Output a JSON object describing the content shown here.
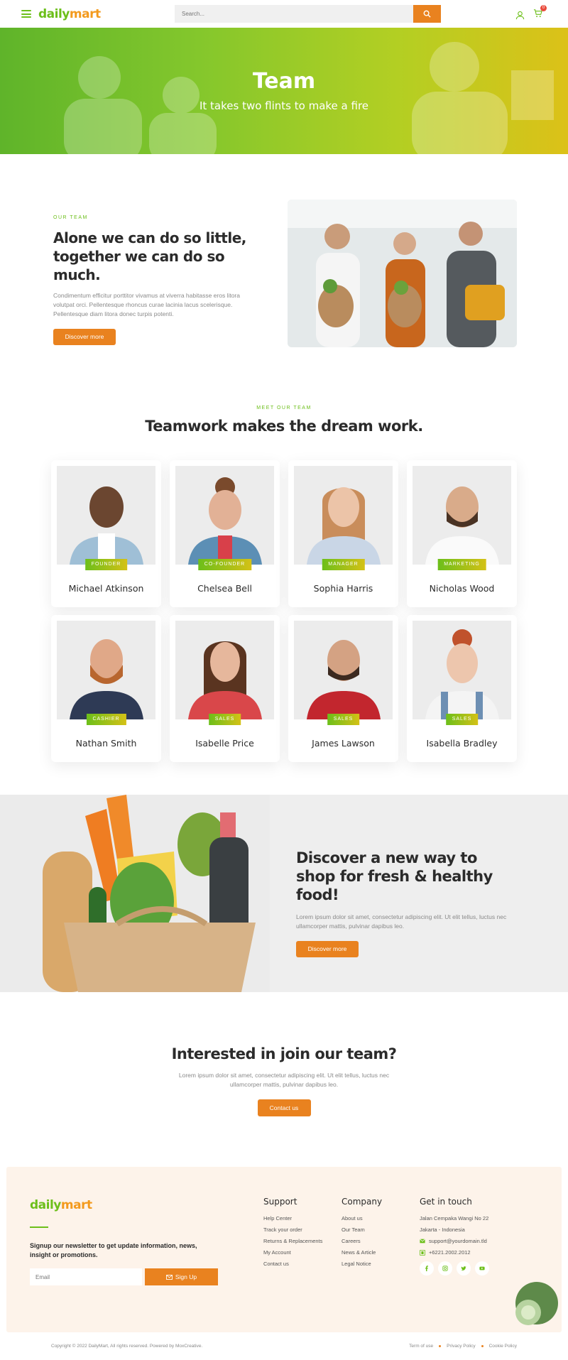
{
  "brand": {
    "logo_left": "daily",
    "logo_right": "mart",
    "green": "#6cbf1a",
    "orange": "#e9821f"
  },
  "header": {
    "search_placeholder": "Search...",
    "cart_count": "0"
  },
  "hero": {
    "title": "Team",
    "subtitle": "It takes two flints to make a fire"
  },
  "intro": {
    "eyebrow": "OUR TEAM",
    "heading": "Alone we can do so little, together we can do so much.",
    "description": "Condimentum efficitur porttitor vivamus at viverra habitasse eros litora volutpat orci. Pellentesque rhoncus curae lacinia lacus scelerisque. Pellentesque diam litora donec turpis potenti.",
    "button": "Discover more"
  },
  "team": {
    "eyebrow": "MEET OUR TEAM",
    "heading": "Teamwork makes the dream work.",
    "members": [
      {
        "role": "FOUNDER",
        "name": "Michael Atkinson"
      },
      {
        "role": "CO-FOUNDER",
        "name": "Chelsea Bell"
      },
      {
        "role": "MANAGER",
        "name": "Sophia Harris"
      },
      {
        "role": "MARKETING",
        "name": "Nicholas Wood"
      },
      {
        "role": "CASHIER",
        "name": "Nathan Smith"
      },
      {
        "role": "SALES",
        "name": "Isabelle Price"
      },
      {
        "role": "SALES",
        "name": "James Lawson"
      },
      {
        "role": "SALES",
        "name": "Isabella Bradley"
      }
    ]
  },
  "discover": {
    "heading": "Discover a new way to shop for fresh & healthy food!",
    "description": "Lorem ipsum dolor sit amet, consectetur adipiscing elit. Ut elit tellus, luctus nec ullamcorper mattis, pulvinar dapibus leo.",
    "button": "Discover more"
  },
  "join": {
    "heading": "Interested in join our team?",
    "description": "Lorem ipsum dolor sit amet, consectetur adipiscing elit. Ut elit tellus, luctus nec ullamcorper mattis, pulvinar dapibus leo.",
    "button": "Contact us"
  },
  "footer": {
    "newsletter": "Signup our newsletter to get update information, news, insight or promotions.",
    "email_placeholder": "Email",
    "signup_button": "Sign Up",
    "support": {
      "title": "Support",
      "links": [
        "Help Center",
        "Track your order",
        "Returns & Replacements",
        "My Account",
        "Contact us"
      ]
    },
    "company": {
      "title": "Company",
      "links": [
        "About us",
        "Our Team",
        "Careers",
        "News & Article",
        "Legal Notice"
      ]
    },
    "contact": {
      "title": "Get in touch",
      "address1": "Jalan Cempaka Wangi No 22",
      "address2": "Jakarta - Indonesia",
      "email": "support@yourdomain.tld",
      "phone": "+6221.2002.2012"
    },
    "social_icons": [
      "facebook-icon",
      "instagram-icon",
      "twitter-icon",
      "youtube-icon"
    ]
  },
  "bottom": {
    "copyright": "Copyright © 2022 DailyMart, All rights reserved. Powered by MoxCreative.",
    "links": [
      "Term of use",
      "Privacy Policy",
      "Cookie Policy"
    ]
  }
}
